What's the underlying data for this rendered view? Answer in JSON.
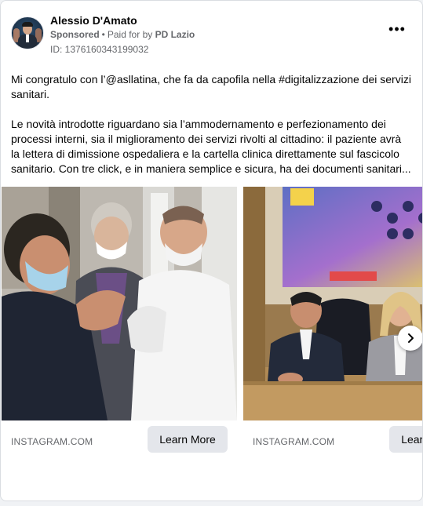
{
  "post": {
    "author": "Alessio D'Amato",
    "sponsored": "Sponsored",
    "paid_for_by": "Paid for by",
    "sponsor": "PD Lazio",
    "id": "ID: 1376160343199032",
    "more_glyph": "•••",
    "paragraph1": "Mi congratulo con l’@asllatina, che fa da capofila nella #digitalizzazione dei servizi sanitari.",
    "paragraph2": "Le novità introdotte riguardano sia l’ammodernamento e perfezionamento dei processi interni, sia il miglioramento dei servizi rivolti al cittadino: il paziente avrà la lettera di dimissione ospedaliera e la cartella clinica direttamente sul fascicolo sanitario. Con tre click, e in maniera semplice e sicura, ha dei documenti sanitari..."
  },
  "carousel": {
    "cards": [
      {
        "domain": "INSTAGRAM.COM",
        "cta": "Learn More"
      },
      {
        "domain": "INSTAGRAM.COM",
        "cta": "Learn More"
      }
    ],
    "next_icon": "chevron-right-icon"
  }
}
